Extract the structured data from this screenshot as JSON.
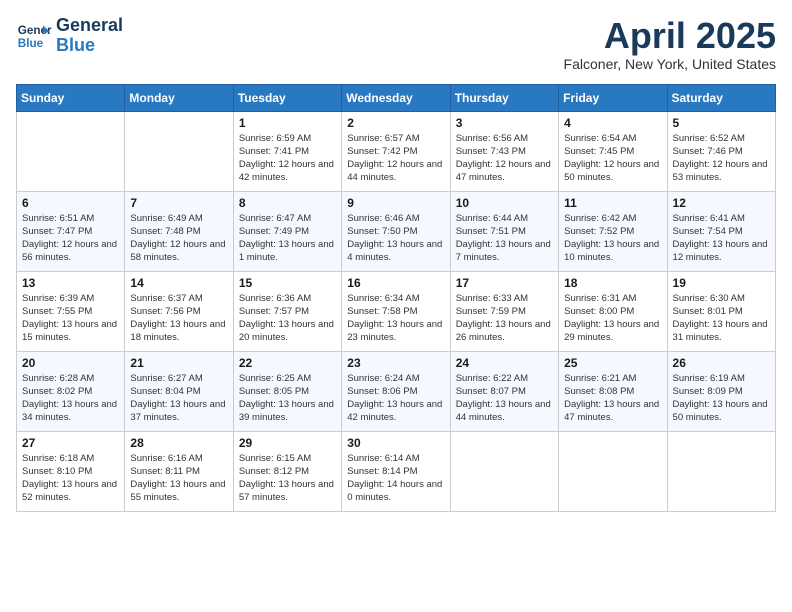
{
  "header": {
    "logo_line1": "General",
    "logo_line2": "Blue",
    "month": "April 2025",
    "location": "Falconer, New York, United States"
  },
  "days_of_week": [
    "Sunday",
    "Monday",
    "Tuesday",
    "Wednesday",
    "Thursday",
    "Friday",
    "Saturday"
  ],
  "weeks": [
    [
      {
        "day": "",
        "info": ""
      },
      {
        "day": "",
        "info": ""
      },
      {
        "day": "1",
        "info": "Sunrise: 6:59 AM\nSunset: 7:41 PM\nDaylight: 12 hours and 42 minutes."
      },
      {
        "day": "2",
        "info": "Sunrise: 6:57 AM\nSunset: 7:42 PM\nDaylight: 12 hours and 44 minutes."
      },
      {
        "day": "3",
        "info": "Sunrise: 6:56 AM\nSunset: 7:43 PM\nDaylight: 12 hours and 47 minutes."
      },
      {
        "day": "4",
        "info": "Sunrise: 6:54 AM\nSunset: 7:45 PM\nDaylight: 12 hours and 50 minutes."
      },
      {
        "day": "5",
        "info": "Sunrise: 6:52 AM\nSunset: 7:46 PM\nDaylight: 12 hours and 53 minutes."
      }
    ],
    [
      {
        "day": "6",
        "info": "Sunrise: 6:51 AM\nSunset: 7:47 PM\nDaylight: 12 hours and 56 minutes."
      },
      {
        "day": "7",
        "info": "Sunrise: 6:49 AM\nSunset: 7:48 PM\nDaylight: 12 hours and 58 minutes."
      },
      {
        "day": "8",
        "info": "Sunrise: 6:47 AM\nSunset: 7:49 PM\nDaylight: 13 hours and 1 minute."
      },
      {
        "day": "9",
        "info": "Sunrise: 6:46 AM\nSunset: 7:50 PM\nDaylight: 13 hours and 4 minutes."
      },
      {
        "day": "10",
        "info": "Sunrise: 6:44 AM\nSunset: 7:51 PM\nDaylight: 13 hours and 7 minutes."
      },
      {
        "day": "11",
        "info": "Sunrise: 6:42 AM\nSunset: 7:52 PM\nDaylight: 13 hours and 10 minutes."
      },
      {
        "day": "12",
        "info": "Sunrise: 6:41 AM\nSunset: 7:54 PM\nDaylight: 13 hours and 12 minutes."
      }
    ],
    [
      {
        "day": "13",
        "info": "Sunrise: 6:39 AM\nSunset: 7:55 PM\nDaylight: 13 hours and 15 minutes."
      },
      {
        "day": "14",
        "info": "Sunrise: 6:37 AM\nSunset: 7:56 PM\nDaylight: 13 hours and 18 minutes."
      },
      {
        "day": "15",
        "info": "Sunrise: 6:36 AM\nSunset: 7:57 PM\nDaylight: 13 hours and 20 minutes."
      },
      {
        "day": "16",
        "info": "Sunrise: 6:34 AM\nSunset: 7:58 PM\nDaylight: 13 hours and 23 minutes."
      },
      {
        "day": "17",
        "info": "Sunrise: 6:33 AM\nSunset: 7:59 PM\nDaylight: 13 hours and 26 minutes."
      },
      {
        "day": "18",
        "info": "Sunrise: 6:31 AM\nSunset: 8:00 PM\nDaylight: 13 hours and 29 minutes."
      },
      {
        "day": "19",
        "info": "Sunrise: 6:30 AM\nSunset: 8:01 PM\nDaylight: 13 hours and 31 minutes."
      }
    ],
    [
      {
        "day": "20",
        "info": "Sunrise: 6:28 AM\nSunset: 8:02 PM\nDaylight: 13 hours and 34 minutes."
      },
      {
        "day": "21",
        "info": "Sunrise: 6:27 AM\nSunset: 8:04 PM\nDaylight: 13 hours and 37 minutes."
      },
      {
        "day": "22",
        "info": "Sunrise: 6:25 AM\nSunset: 8:05 PM\nDaylight: 13 hours and 39 minutes."
      },
      {
        "day": "23",
        "info": "Sunrise: 6:24 AM\nSunset: 8:06 PM\nDaylight: 13 hours and 42 minutes."
      },
      {
        "day": "24",
        "info": "Sunrise: 6:22 AM\nSunset: 8:07 PM\nDaylight: 13 hours and 44 minutes."
      },
      {
        "day": "25",
        "info": "Sunrise: 6:21 AM\nSunset: 8:08 PM\nDaylight: 13 hours and 47 minutes."
      },
      {
        "day": "26",
        "info": "Sunrise: 6:19 AM\nSunset: 8:09 PM\nDaylight: 13 hours and 50 minutes."
      }
    ],
    [
      {
        "day": "27",
        "info": "Sunrise: 6:18 AM\nSunset: 8:10 PM\nDaylight: 13 hours and 52 minutes."
      },
      {
        "day": "28",
        "info": "Sunrise: 6:16 AM\nSunset: 8:11 PM\nDaylight: 13 hours and 55 minutes."
      },
      {
        "day": "29",
        "info": "Sunrise: 6:15 AM\nSunset: 8:12 PM\nDaylight: 13 hours and 57 minutes."
      },
      {
        "day": "30",
        "info": "Sunrise: 6:14 AM\nSunset: 8:14 PM\nDaylight: 14 hours and 0 minutes."
      },
      {
        "day": "",
        "info": ""
      },
      {
        "day": "",
        "info": ""
      },
      {
        "day": "",
        "info": ""
      }
    ]
  ]
}
